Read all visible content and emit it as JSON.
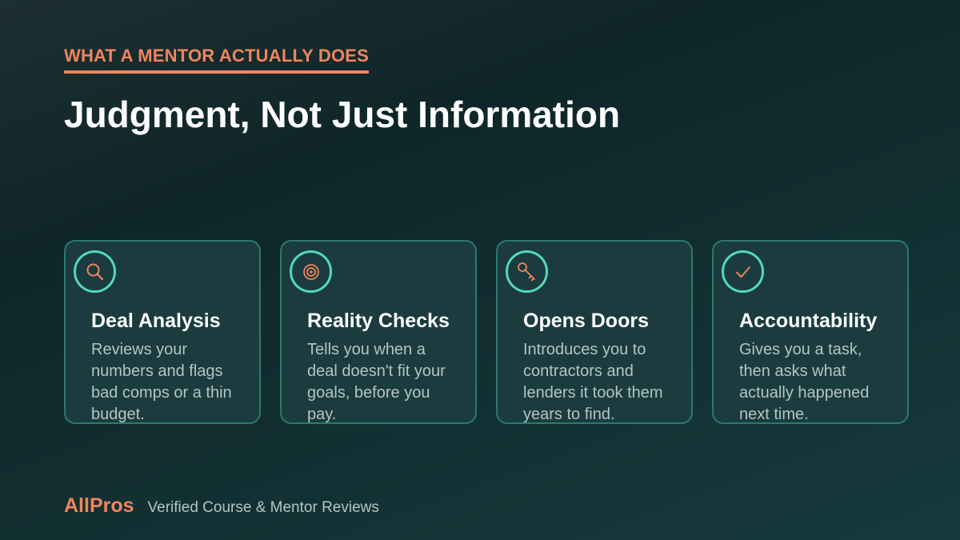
{
  "header": {
    "eyebrow": "WHAT A MENTOR ACTUALLY DOES",
    "title": "Judgment, Not Just Information"
  },
  "cards": [
    {
      "icon": "magnifier-icon",
      "title": "Deal Analysis",
      "description": "Reviews your numbers and flags bad comps or a thin budget."
    },
    {
      "icon": "target-icon",
      "title": "Reality Checks",
      "description": "Tells you when a deal doesn't fit your goals, before you pay."
    },
    {
      "icon": "key-icon",
      "title": "Opens Doors",
      "description": "Introduces you to contractors and lenders it took them years to find."
    },
    {
      "icon": "checkmark-icon",
      "title": "Accountability",
      "description": "Gives you a task, then asks what actually happened next time."
    }
  ],
  "footer": {
    "brand": "AllPros",
    "tagline": "Verified Course & Mentor Reviews"
  },
  "colors": {
    "accent": "#f0855c",
    "icon_ring": "#52d9b8",
    "card_border": "#2b7a6e",
    "card_bg": "#1b3b3f"
  }
}
